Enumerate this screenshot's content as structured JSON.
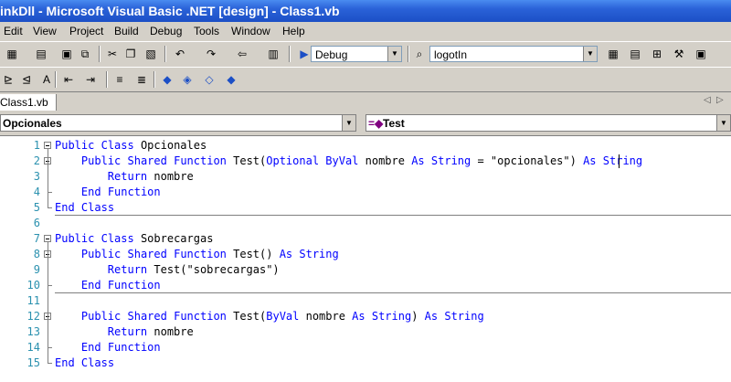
{
  "window": {
    "title": "inkDll - Microsoft Visual Basic .NET [design] - Class1.vb"
  },
  "menu": [
    "Edit",
    "View",
    "Project",
    "Build",
    "Debug",
    "Tools",
    "Window",
    "Help"
  ],
  "toolbar": {
    "config": "Debug",
    "find_combo": "logotIn"
  },
  "tabs": [
    {
      "label": "Class1.vb"
    }
  ],
  "dropdowns": {
    "class_name": "Opcionales",
    "method_name": "Test"
  },
  "code": {
    "line_numbers": [
      "1",
      "2",
      "3",
      "4",
      "5",
      "6",
      "7",
      "8",
      "9",
      "10",
      "11",
      "12",
      "13",
      "14",
      "15"
    ],
    "lines": [
      [
        {
          "t": "Public",
          "c": "kw"
        },
        {
          "t": " "
        },
        {
          "t": "Class",
          "c": "kw"
        },
        {
          "t": " Opcionales"
        }
      ],
      [
        {
          "t": "    "
        },
        {
          "t": "Public",
          "c": "kw"
        },
        {
          "t": " "
        },
        {
          "t": "Shared",
          "c": "kw"
        },
        {
          "t": " "
        },
        {
          "t": "Function",
          "c": "kw"
        },
        {
          "t": " Test("
        },
        {
          "t": "Optional",
          "c": "kw"
        },
        {
          "t": " "
        },
        {
          "t": "ByVal",
          "c": "kw"
        },
        {
          "t": " nombre "
        },
        {
          "t": "As",
          "c": "kw"
        },
        {
          "t": " "
        },
        {
          "t": "String",
          "c": "kw"
        },
        {
          "t": " = \"opcionales\") "
        },
        {
          "t": "As",
          "c": "kw"
        },
        {
          "t": " "
        },
        {
          "t": "String",
          "c": "kw"
        }
      ],
      [
        {
          "t": "        "
        },
        {
          "t": "Return",
          "c": "kw"
        },
        {
          "t": " nombre"
        }
      ],
      [
        {
          "t": "    "
        },
        {
          "t": "End",
          "c": "kw"
        },
        {
          "t": " "
        },
        {
          "t": "Function",
          "c": "kw"
        }
      ],
      [
        {
          "t": "End",
          "c": "kw"
        },
        {
          "t": " "
        },
        {
          "t": "Class",
          "c": "kw"
        }
      ],
      [],
      [
        {
          "t": "Public",
          "c": "kw"
        },
        {
          "t": " "
        },
        {
          "t": "Class",
          "c": "kw"
        },
        {
          "t": " Sobrecargas"
        }
      ],
      [
        {
          "t": "    "
        },
        {
          "t": "Public",
          "c": "kw"
        },
        {
          "t": " "
        },
        {
          "t": "Shared",
          "c": "kw"
        },
        {
          "t": " "
        },
        {
          "t": "Function",
          "c": "kw"
        },
        {
          "t": " Test() "
        },
        {
          "t": "As",
          "c": "kw"
        },
        {
          "t": " "
        },
        {
          "t": "String",
          "c": "kw"
        }
      ],
      [
        {
          "t": "        "
        },
        {
          "t": "Return",
          "c": "kw"
        },
        {
          "t": " Test(\"sobrecargas\")"
        }
      ],
      [
        {
          "t": "    "
        },
        {
          "t": "End",
          "c": "kw"
        },
        {
          "t": " "
        },
        {
          "t": "Function",
          "c": "kw"
        }
      ],
      [],
      [
        {
          "t": "    "
        },
        {
          "t": "Public",
          "c": "kw"
        },
        {
          "t": " "
        },
        {
          "t": "Shared",
          "c": "kw"
        },
        {
          "t": " "
        },
        {
          "t": "Function",
          "c": "kw"
        },
        {
          "t": " Test("
        },
        {
          "t": "ByVal",
          "c": "kw"
        },
        {
          "t": " nombre "
        },
        {
          "t": "As",
          "c": "kw"
        },
        {
          "t": " "
        },
        {
          "t": "String",
          "c": "kw"
        },
        {
          "t": ") "
        },
        {
          "t": "As",
          "c": "kw"
        },
        {
          "t": " "
        },
        {
          "t": "String",
          "c": "kw"
        }
      ],
      [
        {
          "t": "        "
        },
        {
          "t": "Return",
          "c": "kw"
        },
        {
          "t": " nombre"
        }
      ],
      [
        {
          "t": "    "
        },
        {
          "t": "End",
          "c": "kw"
        },
        {
          "t": " "
        },
        {
          "t": "Function",
          "c": "kw"
        }
      ],
      [
        {
          "t": "End",
          "c": "kw"
        },
        {
          "t": " "
        },
        {
          "t": "Class",
          "c": "kw"
        }
      ]
    ]
  },
  "colors": {
    "keyword": "#0000ff",
    "line_number": "#2b91af",
    "title_bar": "#2a62d8"
  }
}
